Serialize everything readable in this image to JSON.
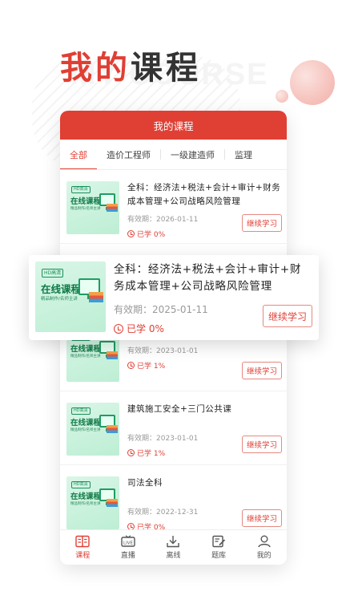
{
  "hero": {
    "title_red": "我的",
    "title_dark": "课程",
    "watermark": "MY COURSE"
  },
  "app": {
    "header_title": "我的课程",
    "tabs": [
      "全部",
      "造价工程师",
      "一级建造师",
      "监理"
    ],
    "active_tab": 0
  },
  "thumbnail": {
    "badge": "HD高清",
    "title": "在线课程",
    "subtitle": "精品制作/名师主讲"
  },
  "courses": [
    {
      "title": "全科：经济法+税法+会计+审计+财务成本管理+公司战略风险管理",
      "valid": "有效期：2026-01-11",
      "progress": "已学 0%",
      "button": "继续学习"
    },
    {
      "title": "",
      "valid": "有效期：2023-01-01",
      "progress": "已学 1%",
      "button": "继续学习"
    },
    {
      "title": "建筑施工安全+三门公共课",
      "valid": "有效期：2023-01-01",
      "progress": "已学 1%",
      "button": "继续学习"
    },
    {
      "title": "司法全科",
      "valid": "有效期：2022-12-31",
      "progress": "已学 0%",
      "button": "继续学习"
    }
  ],
  "featured": {
    "title": "全科：经济法+税法+会计+审计+财务成本管理+公司战略风险管理",
    "valid": "有效期：2025-01-11",
    "progress": "已学 0%",
    "button": "继续学习"
  },
  "nav": [
    {
      "label": "课程",
      "icon": "book-icon",
      "active": true
    },
    {
      "label": "直播",
      "icon": "live-tv-icon",
      "active": false
    },
    {
      "label": "离线",
      "icon": "download-icon",
      "active": false
    },
    {
      "label": "题库",
      "icon": "edit-icon",
      "active": false
    },
    {
      "label": "我的",
      "icon": "user-icon",
      "active": false
    }
  ],
  "colors": {
    "accent": "#e03f34",
    "thumb_green": "#bdeed4"
  }
}
